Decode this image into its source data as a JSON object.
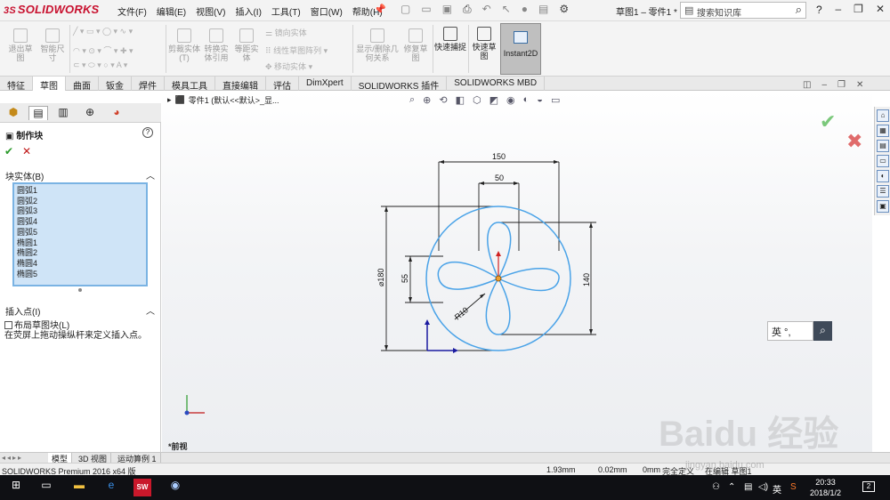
{
  "app": {
    "logo": "SOLIDWORKS",
    "logo_mark": "3S"
  },
  "menu": [
    "文件(F)",
    "编辑(E)",
    "视图(V)",
    "插入(I)",
    "工具(T)",
    "窗口(W)",
    "帮助(H)"
  ],
  "doc_title": "草图1 – 零件1 *",
  "search": {
    "placeholder": "搜索知识库"
  },
  "window_buttons": {
    "help": "?",
    "min": "–",
    "max": "❐",
    "close": "✕"
  },
  "toolbar": {
    "exit_sketch": "退出草图",
    "smart_dim": "智能尺寸",
    "trim": "剪裁实体(T)",
    "convert": "转换实体引用",
    "offset": "等距实体",
    "mirror": "镜向实体",
    "linear_pattern": "线性草图阵列",
    "move": "移动实体",
    "display_relations": "显示/删除几何关系",
    "repair": "修复草图",
    "quick_snap": "快速捕捉",
    "rapid_sketch": "快速草图",
    "instant2d": "Instant2D"
  },
  "tabs": [
    "特征",
    "草图",
    "曲面",
    "钣金",
    "焊件",
    "模具工具",
    "直接编辑",
    "评估",
    "DimXpert",
    "SOLIDWORKS 插件",
    "SOLIDWORKS MBD"
  ],
  "active_tab": "草图",
  "property_manager": {
    "title": "制作块",
    "section_entities": "块实体(B)",
    "entities": [
      "圆弧1",
      "圆弧2",
      "圆弧3",
      "圆弧4",
      "圆弧5",
      "椭圆1",
      "椭圆2",
      "椭圆4",
      "椭圆5"
    ],
    "section_insert": "插入点(I)",
    "checkbox": "布局草图块(L)",
    "hint": "在荧屏上拖动操纵杆来定义插入点。"
  },
  "viewport": {
    "breadcrumb": "零件1 (默认<<默认>_显...",
    "view_label": "*前视",
    "ime_text": "英 °,",
    "dimensions": {
      "top_width": "150",
      "inner_width": "50",
      "diameter": "⌀180",
      "height_left": "55",
      "height_right": "140",
      "radius": "R10"
    }
  },
  "bottom_tabs": [
    "模型",
    "3D 视图",
    "运动算例 1"
  ],
  "status": {
    "product": "SOLIDWORKS Premium 2016 x64 版",
    "x": "1.93mm",
    "y": "0.02mm",
    "z": "0mm",
    "state": "完全定义",
    "editing": "在编辑 草图1"
  },
  "taskbar": {
    "time": "20:33",
    "date": "2018/1/2",
    "ime": "英",
    "notifications": "2"
  },
  "watermark": {
    "main": "Baidu 经验",
    "sub": "jingyan.baidu.com"
  },
  "colors": {
    "brand_red": "#c8102e",
    "sketch_blue": "#4aa3e8",
    "selection_blue": "#cfe4f7"
  }
}
